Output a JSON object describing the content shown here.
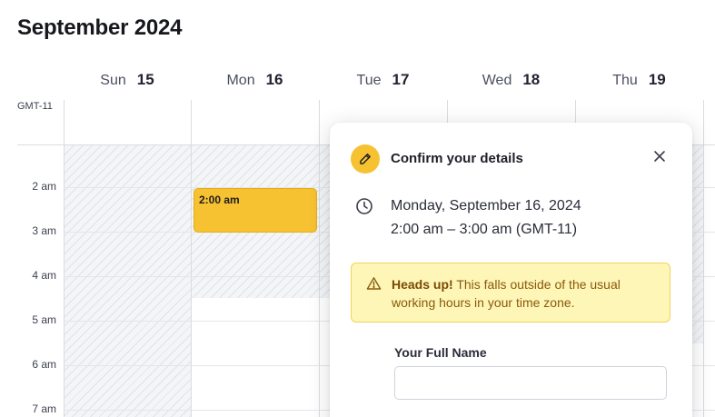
{
  "header": {
    "title": "September 2024"
  },
  "calendar": {
    "timezone": "GMT-11",
    "days": [
      {
        "name": "Sun",
        "date": "15"
      },
      {
        "name": "Mon",
        "date": "16"
      },
      {
        "name": "Tue",
        "date": "17"
      },
      {
        "name": "Wed",
        "date": "18"
      },
      {
        "name": "Thu",
        "date": "19"
      }
    ],
    "hours": [
      "2 am",
      "3 am",
      "4 am",
      "5 am",
      "6 am",
      "7 am"
    ],
    "event": {
      "label": "2:00 am",
      "color": "#f6c232"
    }
  },
  "dialog": {
    "title": "Confirm your details",
    "date_line": "Monday, September 16, 2024",
    "time_line": "2:00 am – 3:00 am (GMT-11)",
    "alert": {
      "heading": "Heads up!",
      "message": " This falls outside of the usual working hours in your time zone."
    },
    "name_field": {
      "label": "Your Full Name",
      "value": "",
      "placeholder": ""
    }
  },
  "colors": {
    "accent": "#f6c232",
    "alert_bg": "#fef6b7",
    "alert_text": "#8a5a0b"
  }
}
